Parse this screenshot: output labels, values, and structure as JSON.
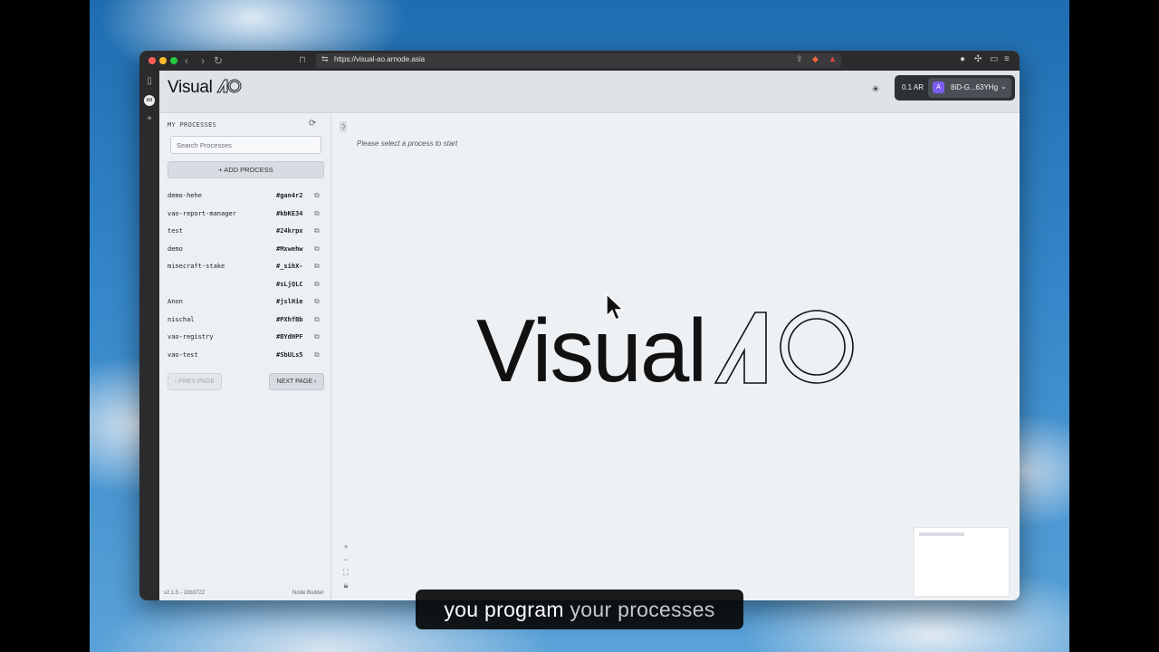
{
  "browser": {
    "url": "https://visual-ao.arnode.asia"
  },
  "app": {
    "logo_text": "Visual",
    "logo_mark_text": "AO",
    "balance": "0.1 AR",
    "wallet_address": "8iD-G...63YHg",
    "avatar_glyph": "A"
  },
  "sidebar": {
    "title": "MY PROCESSES",
    "search_placeholder": "Search Processes",
    "add_label": "ADD PROCESS",
    "processes": [
      {
        "name": "demo-hehe",
        "id": "#gan4r2"
      },
      {
        "name": "vao-report-manager",
        "id": "#kbKE34"
      },
      {
        "name": "test",
        "id": "#24krpx"
      },
      {
        "name": "demo",
        "id": "#Mxwehw"
      },
      {
        "name": "minecraft-stake",
        "id": "#_sihX-"
      },
      {
        "name": "",
        "id": "#sLjQLC"
      },
      {
        "name": "Anon",
        "id": "#jslHie"
      },
      {
        "name": "nischal",
        "id": "#PXhfBb"
      },
      {
        "name": "vao-registry",
        "id": "#BYdHPF"
      },
      {
        "name": "vao-test",
        "id": "#SbULs5"
      }
    ],
    "prev_label": "PREV PAGE",
    "next_label": "NEXT PAGE",
    "version": "v2.1.5 - 10b3722",
    "footer_right": "Node Builder"
  },
  "canvas": {
    "bracket_label": ":)",
    "hint": "Please select a process to start",
    "big_logo_text": "Visual",
    "big_logo_mark_text": "AO"
  },
  "caption": {
    "part1": "you program ",
    "part2": "your processes"
  },
  "colors": {
    "accent_avatar": "#7b5cf0",
    "wallet_bg": "#2d3034"
  }
}
